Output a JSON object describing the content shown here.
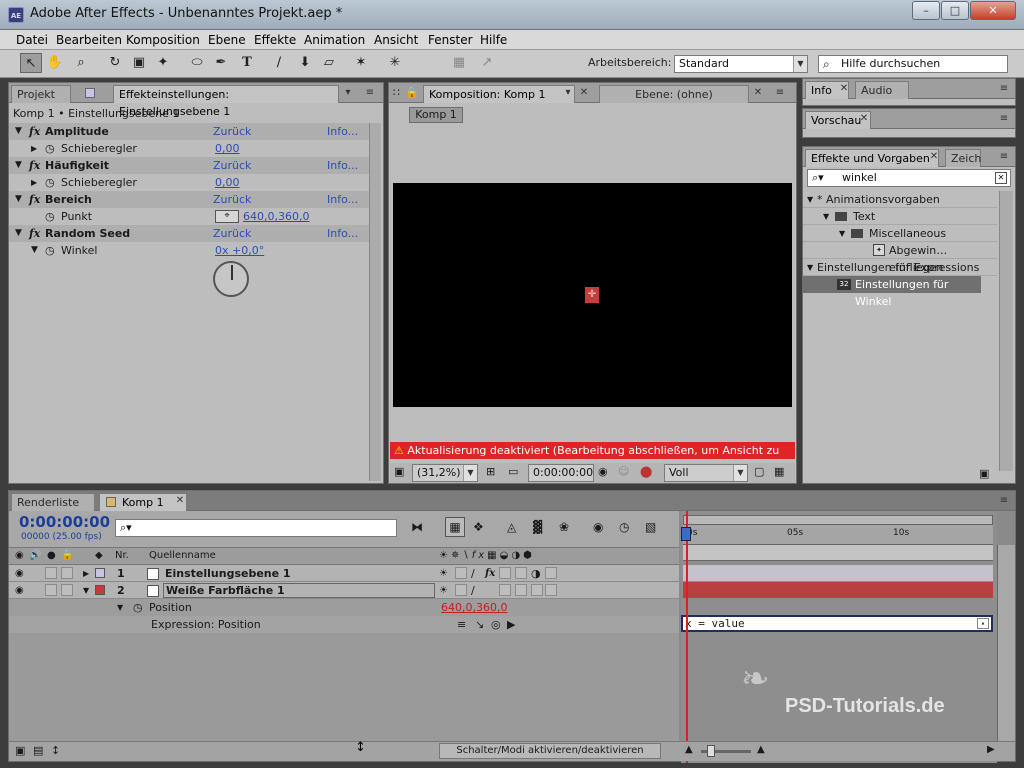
{
  "app": {
    "icon_label": "AE",
    "title": "Adobe After Effects - Unbenanntes Projekt.aep *"
  },
  "window_controls": {
    "minimize": "–",
    "maximize": "□",
    "close": "✕"
  },
  "menu": [
    "Datei",
    "Bearbeiten",
    "Komposition",
    "Ebene",
    "Effekte",
    "Animation",
    "Ansicht",
    "Fenster",
    "Hilfe"
  ],
  "toolbar": {
    "tools": [
      "selection-tool-icon",
      "hand-tool-icon",
      "zoom-tool-icon",
      "rotation-tool-icon",
      "camera-tool-icon",
      "pan-behind-tool-icon",
      "mask-tool-icon",
      "pen-tool-icon",
      "type-tool-icon",
      "brush-tool-icon",
      "clone-stamp-tool-icon",
      "eraser-tool-icon",
      "roto-brush-tool-icon",
      "puppet-pin-tool-icon"
    ],
    "workspace_label": "Arbeitsbereich:",
    "workspace_value": "Standard",
    "help_placeholder": "Hilfe durchsuchen"
  },
  "effects_panel": {
    "tab_project": "Projekt",
    "tab_effects": "Effekteinstellungen: Einstellungsebene 1",
    "breadcrumb": "Komp 1 • Einstellungsebene 1",
    "reset_label": "Zurück",
    "info_label": "Info...",
    "effects": [
      {
        "name": "Amplitude",
        "param": "Schieberegler",
        "value": "0,00"
      },
      {
        "name": "Häufigkeit",
        "param": "Schieberegler",
        "value": "0,00"
      },
      {
        "name": "Bereich",
        "param": "Punkt",
        "value": "640,0,360,0"
      },
      {
        "name": "Random Seed",
        "param": "Winkel",
        "value": "0x +0,0°"
      }
    ]
  },
  "comp_panel": {
    "tab_comp": "Komposition: Komp 1",
    "tab_layer": "Ebene: (ohne)",
    "comp_button": "Komp 1",
    "warning": "Aktualisierung deaktiviert (Bearbeitung abschließen, um Ansicht zu aktualisieren)",
    "zoom": "(31,2%)",
    "timecode": "0:00:00:00",
    "resolution": "Voll"
  },
  "info_panel": {
    "tab_info": "Info",
    "tab_audio": "Audio",
    "tab_preview": "Vorschau"
  },
  "presets_panel": {
    "tab_effects": "Effekte und Vorgaben",
    "tab_char": "Zeich",
    "search_value": "winkel",
    "tree": [
      {
        "label": "* Animationsvorgaben",
        "level": 0,
        "icon": "triangle-down"
      },
      {
        "label": "Text",
        "level": 1,
        "icon": "folder"
      },
      {
        "label": "Miscellaneous",
        "level": 2,
        "icon": "folder"
      },
      {
        "label": "Abgewin…einfliegen",
        "level": 3,
        "icon": "preset"
      },
      {
        "label": "Einstellungen für Expressions",
        "level": 0,
        "icon": "triangle-down"
      },
      {
        "label": "Einstellungen für Winkel",
        "level": 1,
        "icon": "effect",
        "selected": true
      }
    ]
  },
  "timeline": {
    "tab_render": "Renderliste",
    "tab_comp": "Komp 1",
    "timecode": "0:00:00:00",
    "fps": "00000 (25.00 fps)",
    "col_nr": "Nr.",
    "col_source": "Quellenname",
    "layers": [
      {
        "nr": "1",
        "name": "Einstellungsebene 1",
        "label_color": "#c9c3e6",
        "swatch": "#ffffff"
      },
      {
        "nr": "2",
        "name": "Weiße Farbfläche 1",
        "label_color": "#c43b3b",
        "swatch": "#ffffff"
      }
    ],
    "property": "Position",
    "property_value": "640,0,360,0",
    "expression_label": "Expression: Position",
    "expression_text": "x = value",
    "ruler": [
      "0s",
      "05s",
      "10s"
    ],
    "footer_toggle": "Schalter/Modi aktivieren/deaktivieren"
  },
  "watermark": "PSD-Tutorials.de",
  "colors": {
    "warning_red": "#d92020",
    "layer_bar_red": "#b84040",
    "accent_blue": "#2a4fb2"
  }
}
